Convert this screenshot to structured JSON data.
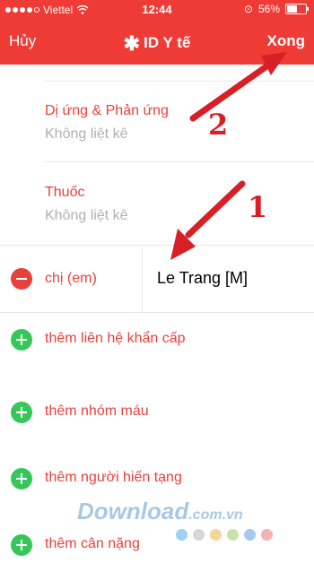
{
  "status_bar": {
    "carrier": "Viettel",
    "time": "12:44",
    "battery": "56%"
  },
  "nav": {
    "cancel": "Hủy",
    "title": "ID Y tế",
    "done": "Xong"
  },
  "sections": [
    {
      "label": "Dị ứng & Phản ứng",
      "value": "Không liệt kê"
    },
    {
      "label": "Thuốc",
      "value": "Không liệt kê"
    }
  ],
  "contact": {
    "relation": "chị (em)",
    "name": "Le Trang [M]"
  },
  "add_items": [
    {
      "label": "thêm liên hệ khẩn cấp"
    },
    {
      "label": "thêm nhóm máu"
    },
    {
      "label": "thêm người hiến tạng"
    },
    {
      "label": "thêm cân nặng"
    }
  ],
  "annotations": {
    "one": "1",
    "two": "2"
  },
  "watermark": {
    "text": "Download",
    "suffix": ".com.vn"
  },
  "colors": {
    "accent": "#ef3b36",
    "add_green": "#35c759",
    "arrow_red": "#d71f25"
  }
}
